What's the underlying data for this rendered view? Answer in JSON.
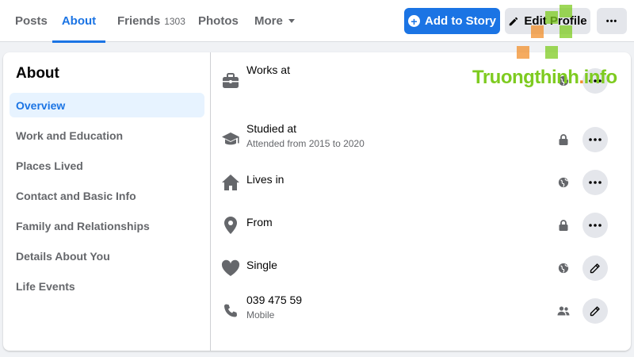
{
  "tabs": {
    "posts": "Posts",
    "about": "About",
    "friends": "Friends",
    "friends_count": "1303",
    "photos": "Photos",
    "more": "More"
  },
  "actions": {
    "add_to_story": "Add to Story",
    "edit_profile": "Edit Profile",
    "more_dots": "•••"
  },
  "sidebar": {
    "title": "About",
    "items": [
      {
        "label": "Overview",
        "active": true
      },
      {
        "label": "Work and Education"
      },
      {
        "label": "Places Lived"
      },
      {
        "label": "Contact and Basic Info"
      },
      {
        "label": "Family and Relationships"
      },
      {
        "label": "Details About You"
      },
      {
        "label": "Life Events"
      }
    ]
  },
  "overview": [
    {
      "icon": "briefcase-icon",
      "text": "Works at",
      "sub": "",
      "audience": "globe-icon",
      "action": "more-dots-icon"
    },
    {
      "icon": "graduation-cap-icon",
      "text": "Studied at",
      "sub": "Attended from 2015 to 2020",
      "audience": "lock-icon",
      "action": "more-dots-icon"
    },
    {
      "icon": "home-icon",
      "text": "Lives in",
      "sub": "",
      "audience": "globe-icon",
      "action": "more-dots-icon"
    },
    {
      "icon": "location-pin-icon",
      "text": "From",
      "sub": "",
      "audience": "lock-icon",
      "action": "more-dots-icon"
    },
    {
      "icon": "heart-icon",
      "text": "Single",
      "sub": "",
      "audience": "globe-icon",
      "action": "pencil-icon"
    },
    {
      "icon": "phone-icon",
      "text": "039 475 59",
      "sub": "Mobile",
      "audience": "friends-icon",
      "action": "pencil-icon"
    }
  ],
  "watermark": {
    "text_main": "Truongthinh",
    "text_dot": ".",
    "text_tld": "info"
  },
  "colors": {
    "accent": "#1b74e4",
    "secondary_text": "#65676b",
    "icon": "#65676b",
    "watermark_green": "#7ecb20",
    "watermark_orange": "#f28f2b"
  }
}
